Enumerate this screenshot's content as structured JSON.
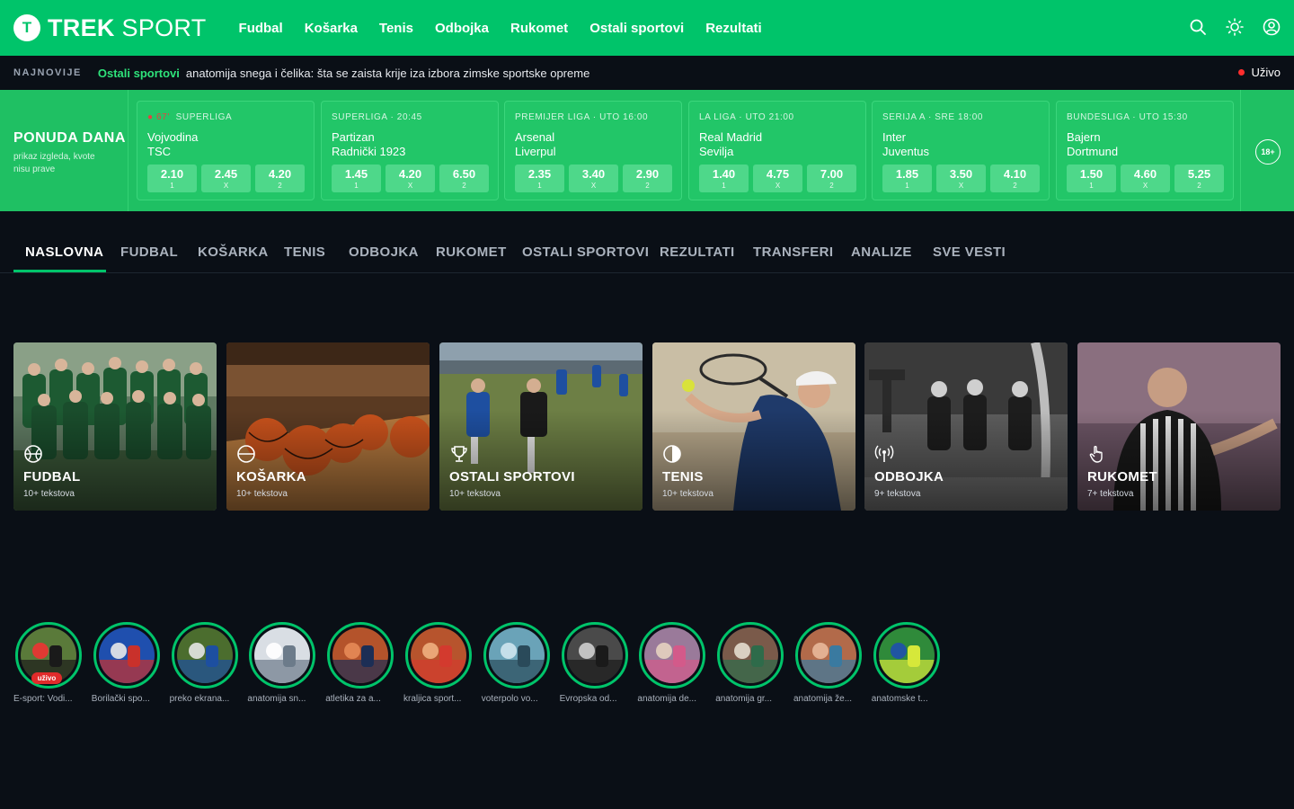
{
  "header": {
    "logo_letter": "T",
    "logo_bold": "TREK",
    "logo_light": " SPORT",
    "nav": [
      "Fudbal",
      "Košarka",
      "Tenis",
      "Odbojka",
      "Rukomet",
      "Ostali sportovi",
      "Rezultati"
    ],
    "icons": [
      "search-icon",
      "theme-toggle-icon",
      "user-account-icon"
    ],
    "brand_color": "#00c46a"
  },
  "ticker": {
    "label": "NAJNOVIJE",
    "category": "Ostali sportovi",
    "headline": "anatomija snega i čelika: šta se zaista krije iza izbora zimske sportske opreme",
    "live_label": "Uživo"
  },
  "offer": {
    "title": "PONUDA DANA",
    "subtitle": "prikaz izgleda, kvote nisu prave",
    "age_badge": "18+",
    "matches": [
      {
        "live": "● 67'",
        "meta": "SUPERLIGA",
        "home": "Vojvodina",
        "away": "TSC",
        "odds": [
          {
            "v": "2.10",
            "k": "1"
          },
          {
            "v": "2.45",
            "k": "X"
          },
          {
            "v": "4.20",
            "k": "2"
          }
        ]
      },
      {
        "live": "",
        "meta": "SUPERLIGA · 20:45",
        "home": "Partizan",
        "away": "Radnički 1923",
        "odds": [
          {
            "v": "1.45",
            "k": "1"
          },
          {
            "v": "4.20",
            "k": "X"
          },
          {
            "v": "6.50",
            "k": "2"
          }
        ]
      },
      {
        "live": "",
        "meta": "PREMIJER LIGA · UTO 16:00",
        "home": "Arsenal",
        "away": "Liverpul",
        "odds": [
          {
            "v": "2.35",
            "k": "1"
          },
          {
            "v": "3.40",
            "k": "X"
          },
          {
            "v": "2.90",
            "k": "2"
          }
        ]
      },
      {
        "live": "",
        "meta": "LA LIGA · UTO 21:00",
        "home": "Real Madrid",
        "away": "Sevilja",
        "odds": [
          {
            "v": "1.40",
            "k": "1"
          },
          {
            "v": "4.75",
            "k": "X"
          },
          {
            "v": "7.00",
            "k": "2"
          }
        ]
      },
      {
        "live": "",
        "meta": "SERIJA A · SRE 18:00",
        "home": "Inter",
        "away": "Juventus",
        "odds": [
          {
            "v": "1.85",
            "k": "1"
          },
          {
            "v": "3.50",
            "k": "X"
          },
          {
            "v": "4.10",
            "k": "2"
          }
        ]
      },
      {
        "live": "",
        "meta": "BUNDESLIGA · UTO 15:30",
        "home": "Bajern",
        "away": "Dortmund",
        "odds": [
          {
            "v": "1.50",
            "k": "1"
          },
          {
            "v": "4.60",
            "k": "X"
          },
          {
            "v": "5.25",
            "k": "2"
          }
        ]
      }
    ]
  },
  "tabs": {
    "items": [
      "NASLOVNA",
      "FUDBAL",
      "KOŠARKA",
      "TENIS",
      "ODBOJKA",
      "RUKOMET",
      "OSTALI SPORTOVI",
      "REZULTATI",
      "TRANSFERI",
      "ANALIZE",
      "SVE VESTI"
    ],
    "active": "NASLOVNA"
  },
  "categories": [
    {
      "name": "FUDBAL",
      "count": "10+ tekstova",
      "icon": "basketball-ball-icon"
    },
    {
      "name": "KOŠARKA",
      "count": "10+ tekstova",
      "icon": "circle-icon"
    },
    {
      "name": "OSTALI SPORTOVI",
      "count": "10+ tekstova",
      "icon": "trophy-icon"
    },
    {
      "name": "TENIS",
      "count": "10+ tekstova",
      "icon": "half-circle-icon"
    },
    {
      "name": "ODBOJKA",
      "count": "9+ tekstova",
      "icon": "broadcast-icon"
    },
    {
      "name": "RUKOMET",
      "count": "7+ tekstova",
      "icon": "hand-pointer-icon"
    }
  ],
  "stories": [
    {
      "caption": "E-sport: Vodi...",
      "badge": "uživo"
    },
    {
      "caption": "Borilački spo..."
    },
    {
      "caption": "preko ekrana..."
    },
    {
      "caption": "anatomija sn..."
    },
    {
      "caption": "atletika za a..."
    },
    {
      "caption": "kraljica sport..."
    },
    {
      "caption": "voterpolo vo..."
    },
    {
      "caption": "Evropska od..."
    },
    {
      "caption": "anatomija de..."
    },
    {
      "caption": "anatomija gr..."
    },
    {
      "caption": "anatomija že..."
    },
    {
      "caption": "anatomske t..."
    }
  ]
}
